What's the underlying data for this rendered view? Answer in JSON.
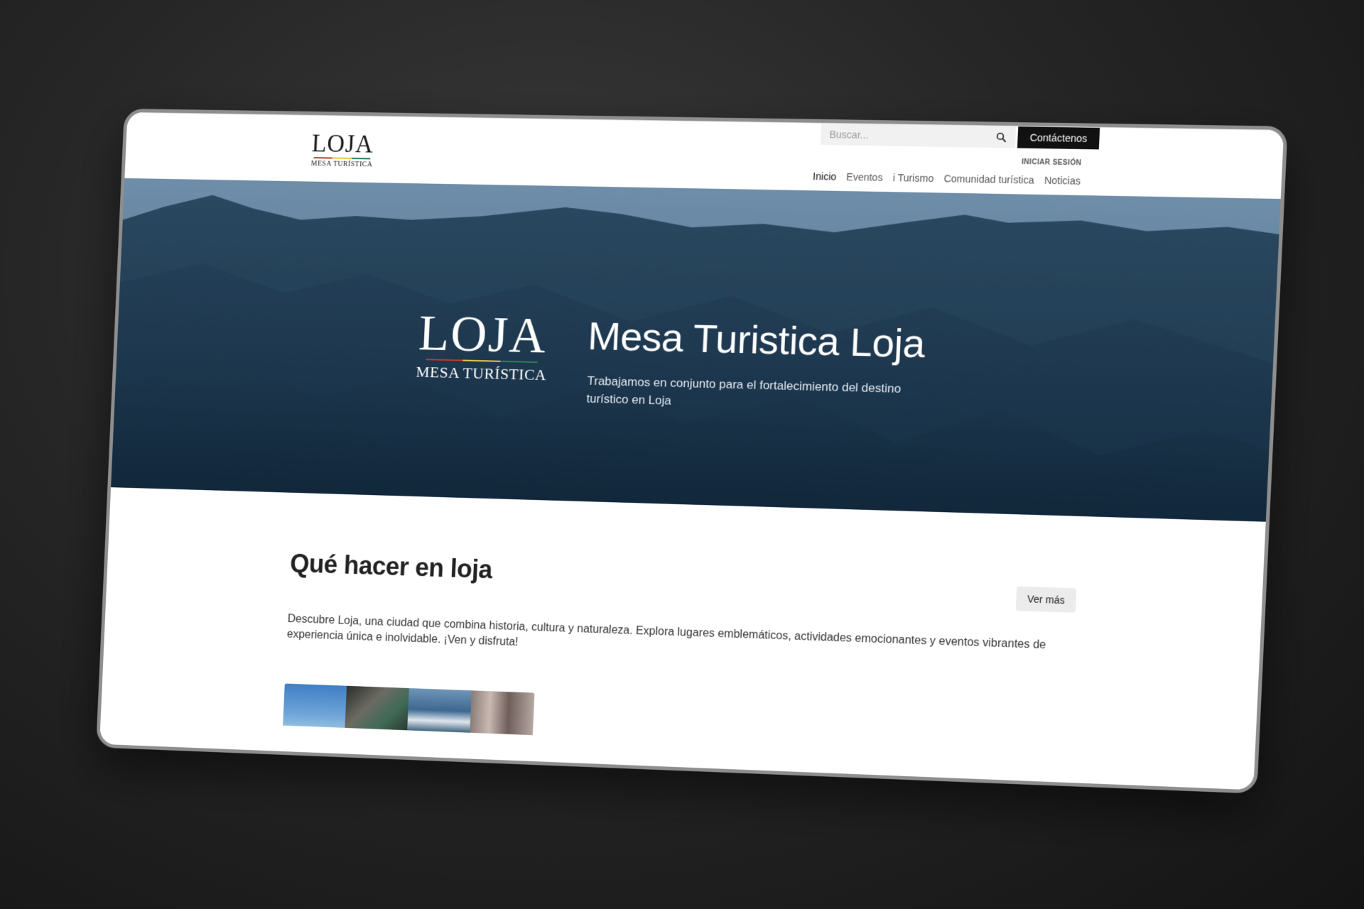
{
  "header": {
    "logo_text": "LOJA",
    "logo_subtext": "MESA TURÍSTICA",
    "search_placeholder": "Buscar...",
    "contact_label": "Contáctenos",
    "login_label": "INICIAR SESIÓN",
    "nav": [
      {
        "label": "Inicio",
        "active": true
      },
      {
        "label": "Eventos"
      },
      {
        "label": "i Turismo"
      },
      {
        "label": "Comunidad turística"
      },
      {
        "label": "Noticias"
      }
    ]
  },
  "hero": {
    "logo_text": "LOJA",
    "logo_subtext": "MESA TURÍSTICA",
    "title": "Mesa Turistica Loja",
    "subtitle": "Trabajamos en conjunto para el fortalecimiento del destino turístico en Loja"
  },
  "section": {
    "title": "Qué hacer en loja",
    "more_label": "Ver más",
    "description": "Descubre Loja, una ciudad que combina historia, cultura y naturaleza. Explora lugares emblemáticos, actividades emocionantes y eventos vibrantes de experiencia única e inolvidable. ¡Ven y disfruta!"
  },
  "colors": {
    "accent_dark": "#111111",
    "logo_bar": [
      "#c0392b",
      "#e7c84a",
      "#2e7d5b"
    ]
  },
  "icons": {
    "search": "search-icon"
  }
}
